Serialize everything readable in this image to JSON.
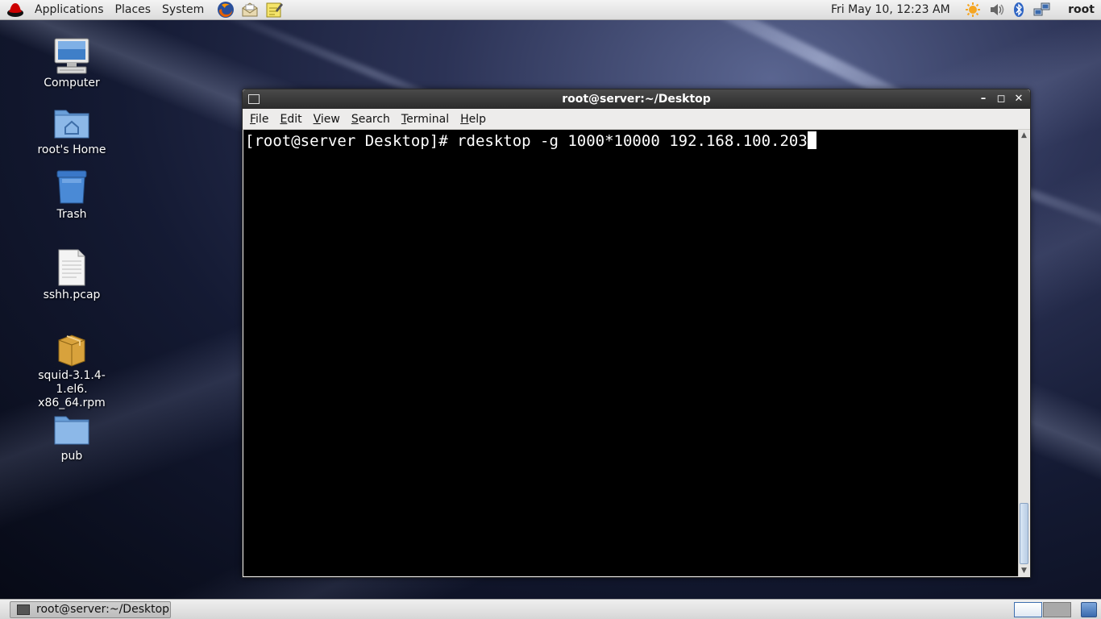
{
  "top_panel": {
    "menus": [
      "Applications",
      "Places",
      "System"
    ],
    "clock": "Fri May 10, 12:23 AM",
    "user": "root",
    "launchers": [
      "firefox-icon",
      "mail-icon",
      "notes-icon"
    ],
    "tray_icons": [
      "weather-icon",
      "volume-icon",
      "bluetooth-icon",
      "network-icon"
    ]
  },
  "desktop": {
    "icons": [
      {
        "label": "Computer",
        "icon": "computer-icon"
      },
      {
        "label": "root's Home",
        "icon": "home-folder-icon"
      },
      {
        "label": "Trash",
        "icon": "trash-icon"
      },
      {
        "label": "sshh.pcap",
        "icon": "text-file-icon"
      },
      {
        "label": "squid-3.1.4-1.el6.x86_64.rpm",
        "label_line1": "squid-3.1.4-1.el6.",
        "label_line2": "x86_64.rpm",
        "icon": "package-icon"
      },
      {
        "label": "pub",
        "icon": "folder-icon"
      }
    ]
  },
  "terminal": {
    "title": "root@server:~/Desktop",
    "menu": [
      {
        "label": "File",
        "mnemonic": "F",
        "rest": "ile"
      },
      {
        "label": "Edit",
        "mnemonic": "E",
        "rest": "dit"
      },
      {
        "label": "View",
        "mnemonic": "V",
        "rest": "iew"
      },
      {
        "label": "Search",
        "mnemonic": "S",
        "rest": "earch"
      },
      {
        "label": "Terminal",
        "mnemonic": "T",
        "rest": "erminal"
      },
      {
        "label": "Help",
        "mnemonic": "H",
        "rest": "elp"
      }
    ],
    "line": "[root@server Desktop]# rdesktop -g 1000*10000 192.168.100.203"
  },
  "bottom_panel": {
    "task": "root@server:~/Desktop"
  },
  "colors": {
    "terminal_bg": "#000000",
    "terminal_fg": "#ffffff",
    "titlebar": "#2b2b2b"
  }
}
